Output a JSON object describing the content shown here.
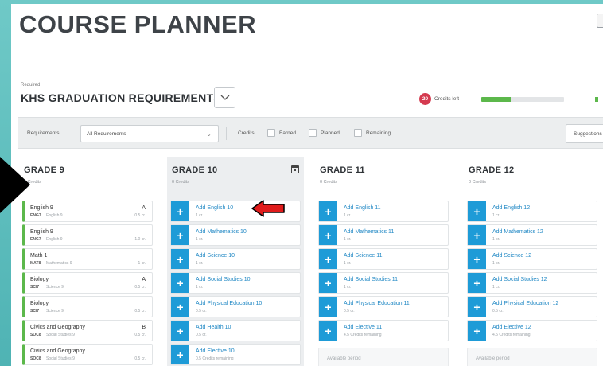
{
  "page": {
    "title": "COURSE PLANNER"
  },
  "requirements": {
    "small_label": "Required",
    "title": "KHS GRADUATION REQUIREMENTS",
    "credits_left_value": "20",
    "credits_left_label": "Credits left",
    "progress_fraction": 0.36
  },
  "filters": {
    "requirements_label": "Requirements",
    "requirements_value": "All Requirements",
    "credits_label": "Credits",
    "earned_label": "Earned",
    "planned_label": "Planned",
    "remaining_label": "Remaining",
    "suggestions_label": "Suggestions"
  },
  "grades": [
    {
      "title": "GRADE 9",
      "subtitle": "8 Credits",
      "courses": [
        {
          "name": "English 9",
          "code": "ENG7",
          "sub": "English 9",
          "grade": "A",
          "credits": "0.5 cr."
        },
        {
          "name": "English 9",
          "code": "ENG7",
          "sub": "English 9",
          "grade": "",
          "credits": "1.0 cr."
        },
        {
          "name": "Math 1",
          "code": "MAT8",
          "sub": "Mathematics 9",
          "grade": "",
          "credits": "1 cr."
        },
        {
          "name": "Biology",
          "code": "SCI7",
          "sub": "Science 9",
          "grade": "A",
          "credits": "0.5 cr."
        },
        {
          "name": "Biology",
          "code": "SCI7",
          "sub": "Science 9",
          "grade": "",
          "credits": "0.5 cr."
        },
        {
          "name": "Civics and Geography",
          "code": "SOC8",
          "sub": "Social Studies 9",
          "grade": "B",
          "credits": "0.5 cr."
        },
        {
          "name": "Civics and Geography",
          "code": "SOC8",
          "sub": "Social Studies 9",
          "grade": "",
          "credits": "0.5 cr."
        }
      ]
    },
    {
      "title": "GRADE 10",
      "subtitle": "0 Credits",
      "adds": [
        {
          "name": "Add English 10",
          "sub": "1 cr."
        },
        {
          "name": "Add Mathematics 10",
          "sub": "1 cr."
        },
        {
          "name": "Add Science 10",
          "sub": "1 cr."
        },
        {
          "name": "Add Social Studies 10",
          "sub": "1 cr."
        },
        {
          "name": "Add Physical Education 10",
          "sub": "0.5 cr."
        },
        {
          "name": "Add Health 10",
          "sub": "0.5 cr."
        },
        {
          "name": "Add Elective 10",
          "sub": "0.5 Credits remaining"
        }
      ]
    },
    {
      "title": "GRADE 11",
      "subtitle": "0 Credits",
      "adds": [
        {
          "name": "Add English 11",
          "sub": "1 cr."
        },
        {
          "name": "Add Mathematics 11",
          "sub": "1 cr."
        },
        {
          "name": "Add Science 11",
          "sub": "1 cr."
        },
        {
          "name": "Add Social Studies 11",
          "sub": "1 cr."
        },
        {
          "name": "Add Physical Education 11",
          "sub": "0.5 cr."
        },
        {
          "name": "Add Elective 11",
          "sub": "4.5 Credits remaining"
        }
      ],
      "available": "Available period"
    },
    {
      "title": "GRADE 12",
      "subtitle": "0 Credits",
      "adds": [
        {
          "name": "Add English 12",
          "sub": "1 cr."
        },
        {
          "name": "Add Mathematics 12",
          "sub": "1 cr."
        },
        {
          "name": "Add Science 12",
          "sub": "1 cr."
        },
        {
          "name": "Add Social Studies 12",
          "sub": "1 cr."
        },
        {
          "name": "Add Physical Education 12",
          "sub": "0.5 cr."
        },
        {
          "name": "Add Elective 12",
          "sub": "4.5 Credits remaining"
        }
      ],
      "available": "Available period"
    }
  ],
  "colors": {
    "accent_blue": "#1e9bd7",
    "earned_green": "#5cb84b",
    "credits_badge_red": "#d43a4f",
    "annotation_arrow_red": "#e01b1b",
    "background_teal": "#5fbfbe"
  },
  "icons": {
    "dropdown": "chevron-down-icon",
    "add": "plus-icon",
    "schedule": "calendar-icon",
    "annotation": "red-arrow-icon"
  }
}
